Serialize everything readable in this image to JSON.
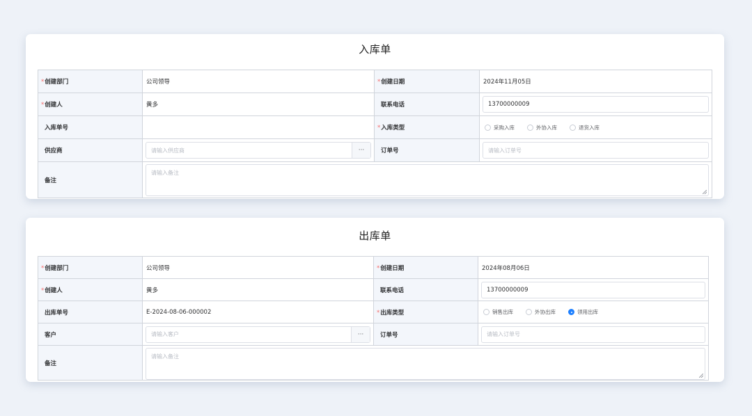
{
  "inbound": {
    "title": "入库单",
    "rows": {
      "dept_label": "创建部门",
      "dept_value": "公司领导",
      "date_label": "创建日期",
      "date_value": "2024年11月05日",
      "creator_label": "创建人",
      "creator_value": "黄多",
      "phone_label": "联系电话",
      "phone_value": "13700000009",
      "no_label": "入库单号",
      "no_value": "",
      "type_label": "入库类型",
      "type_options": [
        "采购入库",
        "外协入库",
        "退货入库"
      ],
      "supplier_label": "供应商",
      "supplier_placeholder": "请输入供应商",
      "picker_glyph": "···",
      "order_label": "订单号",
      "order_placeholder": "请输入订单号",
      "remark_label": "备注",
      "remark_placeholder": "请输入备注"
    }
  },
  "outbound": {
    "title": "出库单",
    "rows": {
      "dept_label": "创建部门",
      "dept_value": "公司领导",
      "date_label": "创建日期",
      "date_value": "2024年08月06日",
      "creator_label": "创建人",
      "creator_value": "黄多",
      "phone_label": "联系电话",
      "phone_value": "13700000009",
      "no_label": "出库单号",
      "no_value": "E-2024-08-06-000002",
      "type_label": "出库类型",
      "type_options": [
        "销售出库",
        "外协出库",
        "领用出库"
      ],
      "type_selected": "领用出库",
      "customer_label": "客户",
      "customer_placeholder": "请输入客户",
      "picker_glyph": "···",
      "order_label": "订单号",
      "order_placeholder": "请输入订单号",
      "remark_label": "备注",
      "remark_placeholder": "请输入备注"
    }
  },
  "colors": {
    "page_bg": "#eef2f8",
    "label_bg": "#f3f6fb",
    "required": "#f56c6c",
    "radio_selected": "#1e80ff",
    "placeholder": "#b8bcc4"
  }
}
